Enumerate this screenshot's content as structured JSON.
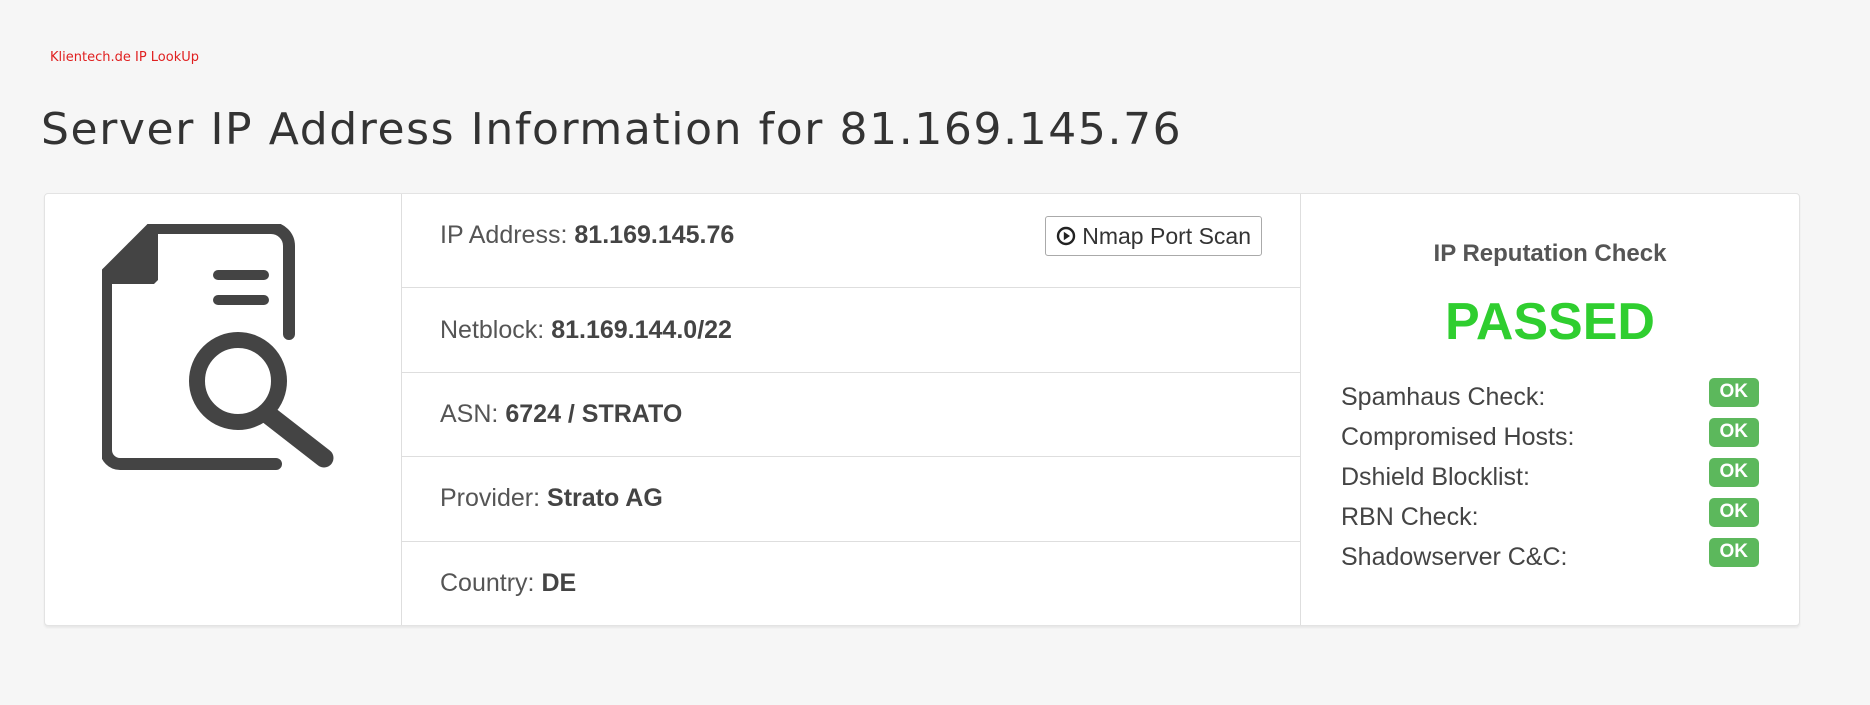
{
  "site_link": "Klientech.de IP LookUp",
  "page_title": "Server IP Address Information for 81.169.145.76",
  "info": {
    "ip_address": {
      "label": "IP Address:",
      "value": "81.169.145.76"
    },
    "netblock": {
      "label": "Netblock:",
      "value": "81.169.144.0/22"
    },
    "asn": {
      "label": "ASN:",
      "value": "6724 / STRATO"
    },
    "provider": {
      "label": "Provider:",
      "value": "Strato AG"
    },
    "country": {
      "label": "Country:",
      "value": "DE"
    }
  },
  "nmap_button": {
    "label": "Nmap Port Scan",
    "icon": "play-circle-icon"
  },
  "reputation": {
    "title": "IP Reputation Check",
    "status": "PASSED",
    "status_color": "#2fce2f",
    "checks": [
      {
        "label": "Spamhaus Check:",
        "result": "OK"
      },
      {
        "label": "Compromised Hosts:",
        "result": "OK"
      },
      {
        "label": "Dshield Blocklist:",
        "result": "OK"
      },
      {
        "label": "RBN Check:",
        "result": "OK"
      },
      {
        "label": "Shadowserver C&C:",
        "result": "OK"
      }
    ]
  },
  "icons": {
    "main": "document-search-icon"
  },
  "colors": {
    "link": "#e02020",
    "ok_badge": "#5cb85c",
    "background": "#f6f6f6"
  }
}
